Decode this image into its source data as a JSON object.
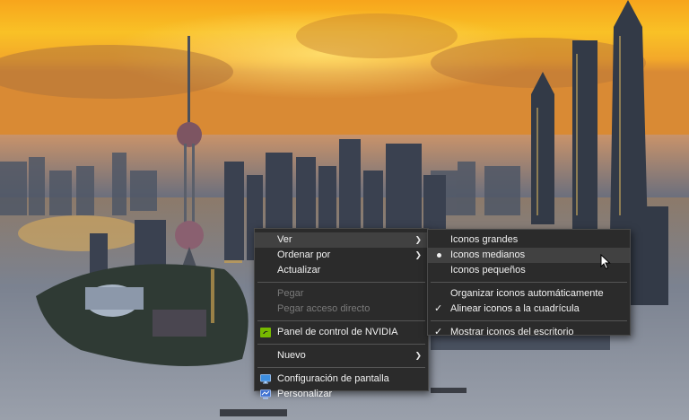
{
  "context_menu": {
    "items": [
      {
        "label": "Ver",
        "submenu": true
      },
      {
        "label": "Ordenar por",
        "submenu": true
      },
      {
        "label": "Actualizar"
      },
      {
        "label": "Pegar",
        "disabled": true
      },
      {
        "label": "Pegar acceso directo",
        "disabled": true
      },
      {
        "label": "Panel de control de NVIDIA",
        "icon": "nvidia-icon"
      },
      {
        "label": "Nuevo",
        "submenu": true
      },
      {
        "label": "Configuración de pantalla",
        "icon": "display-settings-icon"
      },
      {
        "label": "Personalizar",
        "icon": "personalize-icon"
      }
    ]
  },
  "view_submenu": {
    "items": [
      {
        "label": "Iconos grandes"
      },
      {
        "label": "Iconos medianos",
        "selected": true
      },
      {
        "label": "Iconos pequeños"
      },
      {
        "label": "Organizar iconos automáticamente"
      },
      {
        "label": "Alinear iconos a la cuadrícula",
        "checked": true
      },
      {
        "label": "Mostrar iconos del escritorio",
        "checked": true
      }
    ]
  },
  "colors": {
    "menu_background": "#2b2b2b",
    "menu_hover": "#414141",
    "menu_text": "#f2f2f2",
    "disabled_text": "#7a7a7a",
    "nvidia_green": "#76b900"
  }
}
